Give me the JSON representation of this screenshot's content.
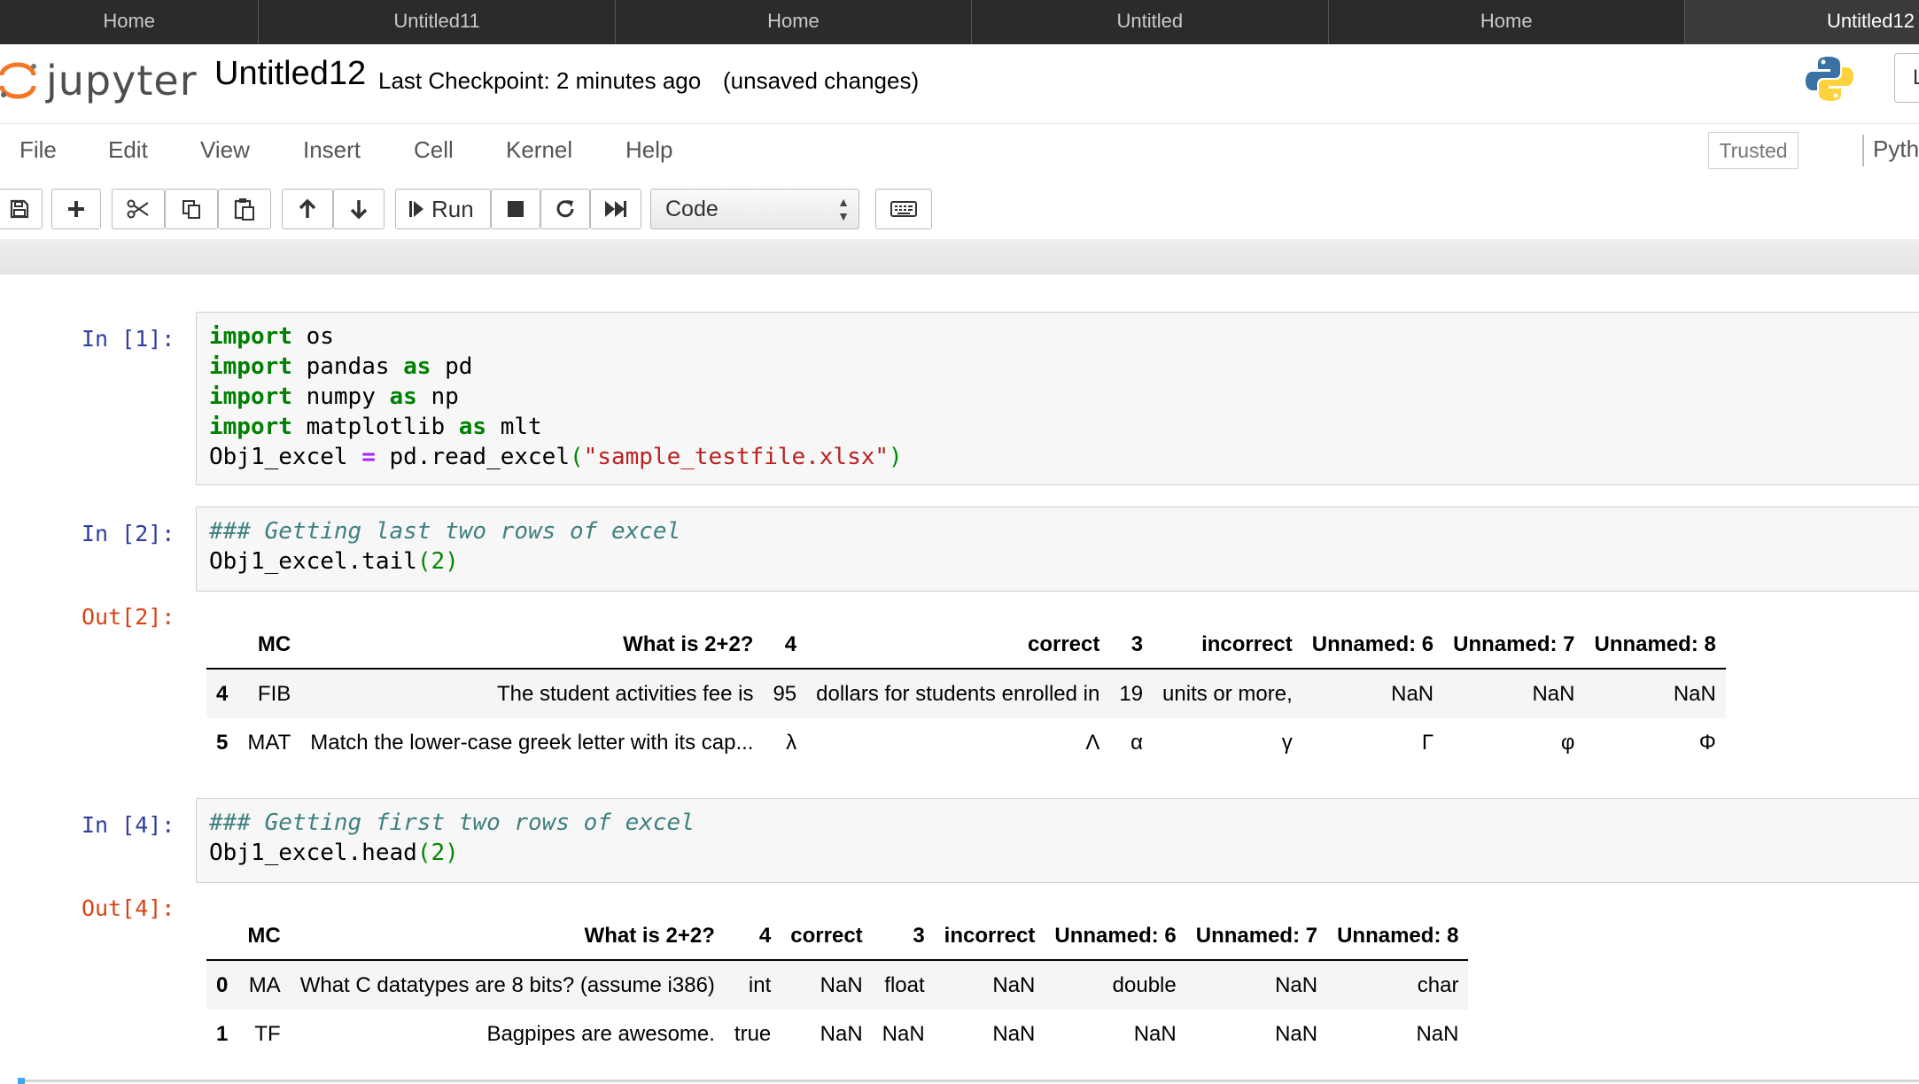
{
  "browser_tabs": [
    {
      "label": "Home",
      "active": false
    },
    {
      "label": "Untitled11",
      "active": false
    },
    {
      "label": "Home",
      "active": false
    },
    {
      "label": "Untitled",
      "active": false
    },
    {
      "label": "Home",
      "active": false
    },
    {
      "label": "Untitled12",
      "active": true
    }
  ],
  "header": {
    "logo_text": "jupyter",
    "notebook_name": "Untitled12",
    "checkpoint": "Last Checkpoint: 2 minutes ago",
    "save_status": "(unsaved changes)",
    "logout_label": "L"
  },
  "menu": {
    "items": [
      "File",
      "Edit",
      "View",
      "Insert",
      "Cell",
      "Kernel",
      "Help"
    ],
    "trusted_label": "Trusted",
    "kernel_name": "Pyth"
  },
  "toolbar": {
    "run_label": "Run",
    "cell_type": "Code",
    "icons": [
      "save-icon",
      "plus-icon",
      "cut-icon",
      "copy-icon",
      "paste-icon",
      "arrow-up-icon",
      "arrow-down-icon",
      "step-forward-icon",
      "stop-icon",
      "restart-icon",
      "fast-forward-icon",
      "keyboard-icon"
    ]
  },
  "cells": [
    {
      "in_prompt": "In [1]:",
      "code": [
        [
          [
            "kw",
            "import"
          ],
          [
            "t",
            " os"
          ]
        ],
        [
          [
            "kw",
            "import"
          ],
          [
            "t",
            " pandas "
          ],
          [
            "kw",
            "as"
          ],
          [
            "t",
            " pd"
          ]
        ],
        [
          [
            "kw",
            "import"
          ],
          [
            "t",
            " numpy "
          ],
          [
            "kw",
            "as"
          ],
          [
            "t",
            " np"
          ]
        ],
        [
          [
            "kw",
            "import"
          ],
          [
            "t",
            " matplotlib "
          ],
          [
            "kw",
            "as"
          ],
          [
            "t",
            " mlt"
          ]
        ],
        [
          [
            "t",
            "Obj1_excel "
          ],
          [
            "op",
            "="
          ],
          [
            "t",
            " pd.read_excel"
          ],
          [
            "num",
            "("
          ],
          [
            "str",
            "\"sample_testfile.xlsx\""
          ],
          [
            "num",
            ")"
          ]
        ]
      ]
    },
    {
      "in_prompt": "In [2]:",
      "code": [
        [
          [
            "cm",
            "### Getting last two rows of excel"
          ]
        ],
        [
          [
            "t",
            "Obj1_excel.tail"
          ],
          [
            "num",
            "(2)"
          ]
        ]
      ],
      "out_prompt": "Out[2]:",
      "table": {
        "columns": [
          "",
          "MC",
          "What is 2+2?",
          "4",
          "correct",
          "3",
          "incorrect",
          "Unnamed: 6",
          "Unnamed: 7",
          "Unnamed: 8"
        ],
        "rows": [
          [
            "4",
            "FIB",
            "The student activities fee is",
            "95",
            "dollars for students enrolled in",
            "19",
            "units or more,",
            "NaN",
            "NaN",
            "NaN"
          ],
          [
            "5",
            "MAT",
            "Match the lower-case greek letter with its cap...",
            "λ",
            "Λ",
            "α",
            "γ",
            "Γ",
            "φ",
            "Φ"
          ]
        ]
      }
    },
    {
      "in_prompt": "In [4]:",
      "code": [
        [
          [
            "cm",
            "### Getting first two rows of excel"
          ]
        ],
        [
          [
            "t",
            "Obj1_excel.head"
          ],
          [
            "num",
            "(2)"
          ]
        ]
      ],
      "out_prompt": "Out[4]:",
      "table": {
        "columns": [
          "",
          "MC",
          "What is 2+2?",
          "4",
          "correct",
          "3",
          "incorrect",
          "Unnamed: 6",
          "Unnamed: 7",
          "Unnamed: 8"
        ],
        "rows": [
          [
            "0",
            "MA",
            "What C datatypes are 8 bits? (assume i386)",
            "int",
            "NaN",
            "float",
            "NaN",
            "double",
            "NaN",
            "char"
          ],
          [
            "1",
            "TF",
            "Bagpipes are awesome.",
            "true",
            "NaN",
            "NaN",
            "NaN",
            "NaN",
            "NaN",
            "NaN"
          ]
        ]
      }
    }
  ]
}
